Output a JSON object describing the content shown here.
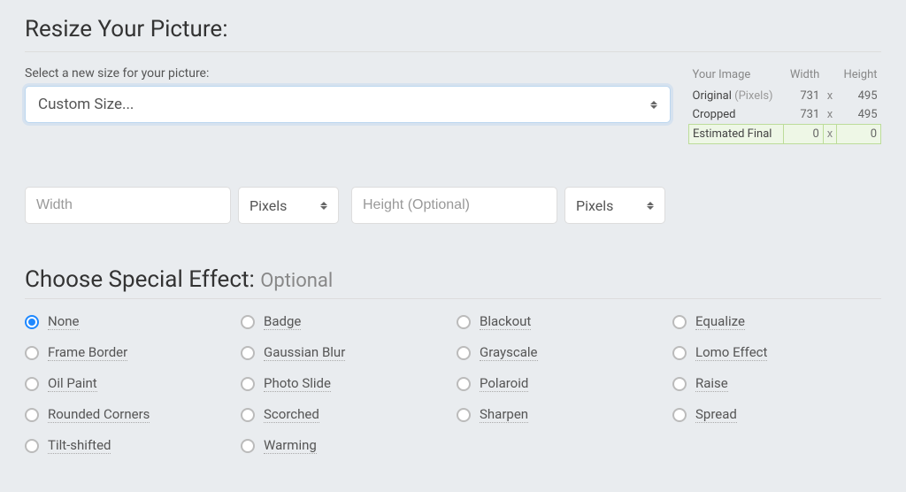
{
  "resize": {
    "title": "Resize Your Picture:",
    "select_label": "Select a new size for your picture:",
    "size_option_selected": "Custom Size...",
    "width_placeholder": "Width",
    "height_placeholder": "Height (Optional)",
    "unit_options_selected": "Pixels"
  },
  "size_table": {
    "header_your_image": "Your Image",
    "header_width": "Width",
    "header_height": "Height",
    "sep": "x",
    "rows": [
      {
        "label": "Original",
        "note": "(Pixels)",
        "width": "731",
        "height": "495"
      },
      {
        "label": "Cropped",
        "note": "",
        "width": "731",
        "height": "495"
      },
      {
        "label": "Estimated Final",
        "note": "",
        "width": "0",
        "height": "0"
      }
    ]
  },
  "effects": {
    "title": "Choose Special Effect:",
    "optional": "Optional",
    "items": [
      "None",
      "Badge",
      "Blackout",
      "Equalize",
      "Frame Border",
      "Gaussian Blur",
      "Grayscale",
      "Lomo Effect",
      "Oil Paint",
      "Photo Slide",
      "Polaroid",
      "Raise",
      "Rounded Corners",
      "Scorched",
      "Sharpen",
      "Spread",
      "Tilt-shifted",
      "Warming"
    ],
    "selected_index": 0
  }
}
